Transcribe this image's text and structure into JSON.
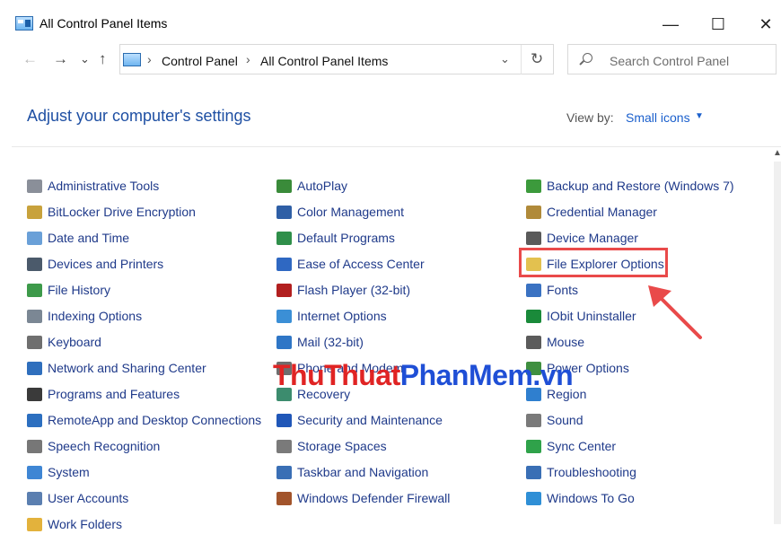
{
  "window": {
    "title": "All Control Panel Items"
  },
  "controls": {
    "minimize": "—",
    "maximize": "☐",
    "close": "✕"
  },
  "nav": {
    "back": "←",
    "forward": "→",
    "recent": "⌄",
    "up": "↑",
    "refresh": "↻",
    "dropdown": "⌄"
  },
  "breadcrumb": {
    "sep": "›",
    "items": [
      "Control Panel",
      "All Control Panel Items"
    ]
  },
  "search": {
    "placeholder": "Search Control Panel"
  },
  "header": {
    "title": "Adjust your computer's settings",
    "view_by_label": "View by:",
    "view_by_value": "Small icons",
    "caret": "▼"
  },
  "scroll": {
    "up": "▲"
  },
  "watermark": {
    "part1": "ThuThuat",
    "part2": "PhanMem.vn"
  },
  "items": {
    "col1": [
      {
        "label": "Administrative Tools",
        "color": "#8a8f99"
      },
      {
        "label": "BitLocker Drive Encryption",
        "color": "#c8a23c"
      },
      {
        "label": "Date and Time",
        "color": "#6aa0d8"
      },
      {
        "label": "Devices and Printers",
        "color": "#4b5a6b"
      },
      {
        "label": "File History",
        "color": "#3d9a4a"
      },
      {
        "label": "Indexing Options",
        "color": "#7b8794"
      },
      {
        "label": "Keyboard",
        "color": "#6f6f6f"
      },
      {
        "label": "Network and Sharing Center",
        "color": "#2f6fbd"
      },
      {
        "label": "Programs and Features",
        "color": "#3a3a3a"
      },
      {
        "label": "RemoteApp and Desktop Connections",
        "color": "#2c6fc0"
      },
      {
        "label": "Speech Recognition",
        "color": "#777777"
      },
      {
        "label": "System",
        "color": "#3f86d4"
      },
      {
        "label": "User Accounts",
        "color": "#5b7fb0"
      },
      {
        "label": "Work Folders",
        "color": "#e3b23c"
      }
    ],
    "col2": [
      {
        "label": "AutoPlay",
        "color": "#3a8b3a"
      },
      {
        "label": "Color Management",
        "color": "#2f5fa6"
      },
      {
        "label": "Default Programs",
        "color": "#2f8f4a"
      },
      {
        "label": "Ease of Access Center",
        "color": "#2f68c2"
      },
      {
        "label": "Flash Player (32-bit)",
        "color": "#b21f1f"
      },
      {
        "label": "Internet Options",
        "color": "#3b8fd6"
      },
      {
        "label": "Mail (32-bit)",
        "color": "#2f76c6"
      },
      {
        "label": "Phone and Modem",
        "color": "#6e6e6e"
      },
      {
        "label": "Recovery",
        "color": "#3c8c6e"
      },
      {
        "label": "Security and Maintenance",
        "color": "#2057b8"
      },
      {
        "label": "Storage Spaces",
        "color": "#7a7a7a"
      },
      {
        "label": "Taskbar and Navigation",
        "color": "#3a6fb5"
      },
      {
        "label": "Windows Defender Firewall",
        "color": "#a2542b"
      }
    ],
    "col3": [
      {
        "label": "Backup and Restore (Windows 7)",
        "color": "#3c9a3c"
      },
      {
        "label": "Credential Manager",
        "color": "#b08a3a"
      },
      {
        "label": "Device Manager",
        "color": "#5a5a5a"
      },
      {
        "label": "File Explorer Options",
        "color": "#e3c14f"
      },
      {
        "label": "Fonts",
        "color": "#3a72c2"
      },
      {
        "label": "IObit Uninstaller",
        "color": "#1a8a3a"
      },
      {
        "label": "Mouse",
        "color": "#5b5b5b"
      },
      {
        "label": "Power Options",
        "color": "#3f8f3f"
      },
      {
        "label": "Region",
        "color": "#2f7fcf"
      },
      {
        "label": "Sound",
        "color": "#7a7a7a"
      },
      {
        "label": "Sync Center",
        "color": "#2fa24a"
      },
      {
        "label": "Troubleshooting",
        "color": "#3a6fb5"
      },
      {
        "label": "Windows To Go",
        "color": "#2f8fd6"
      }
    ]
  }
}
